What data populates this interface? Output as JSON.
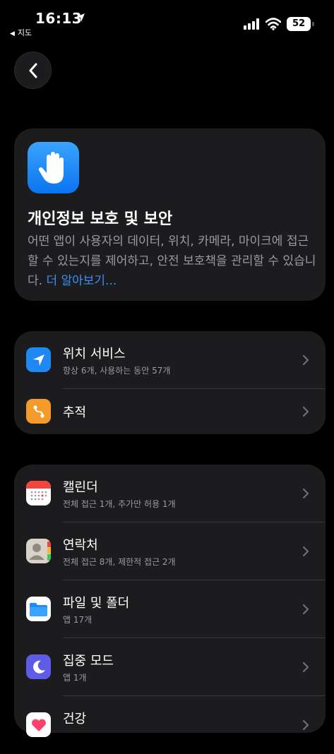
{
  "status_bar": {
    "time": "16:13",
    "back_app": "지도",
    "battery": "52"
  },
  "hero": {
    "title": "개인정보 보호 및 보안",
    "description": "어떤 앱이 사용자의 데이터, 위치, 카메라, 마이크에 접근할 수 있는지를 제어하고, 안전 보호책을 관리할 수 있습니다.",
    "link": "더 알아보기..."
  },
  "privacy_rows": [
    {
      "title": "위치 서비스",
      "subtitle": "항상 6개, 사용하는 동안 57개",
      "icon": "location-arrow-icon",
      "color": "#1e88f5"
    },
    {
      "title": "추적",
      "subtitle": "",
      "icon": "tracking-icon",
      "color": "#f39a2b"
    }
  ],
  "app_rows": [
    {
      "title": "캘린더",
      "subtitle": "전체 접근 1개, 추가만 허용 1개",
      "icon": "calendar-icon"
    },
    {
      "title": "연락처",
      "subtitle": "전체 접근 8개, 제한적 접근 2개",
      "icon": "contacts-icon"
    },
    {
      "title": "파일 및 폴더",
      "subtitle": "앱 17개",
      "icon": "folder-icon"
    },
    {
      "title": "집중 모드",
      "subtitle": "앱 1개",
      "icon": "moon-icon"
    },
    {
      "title": "건강",
      "subtitle": "",
      "icon": "heart-icon"
    }
  ]
}
